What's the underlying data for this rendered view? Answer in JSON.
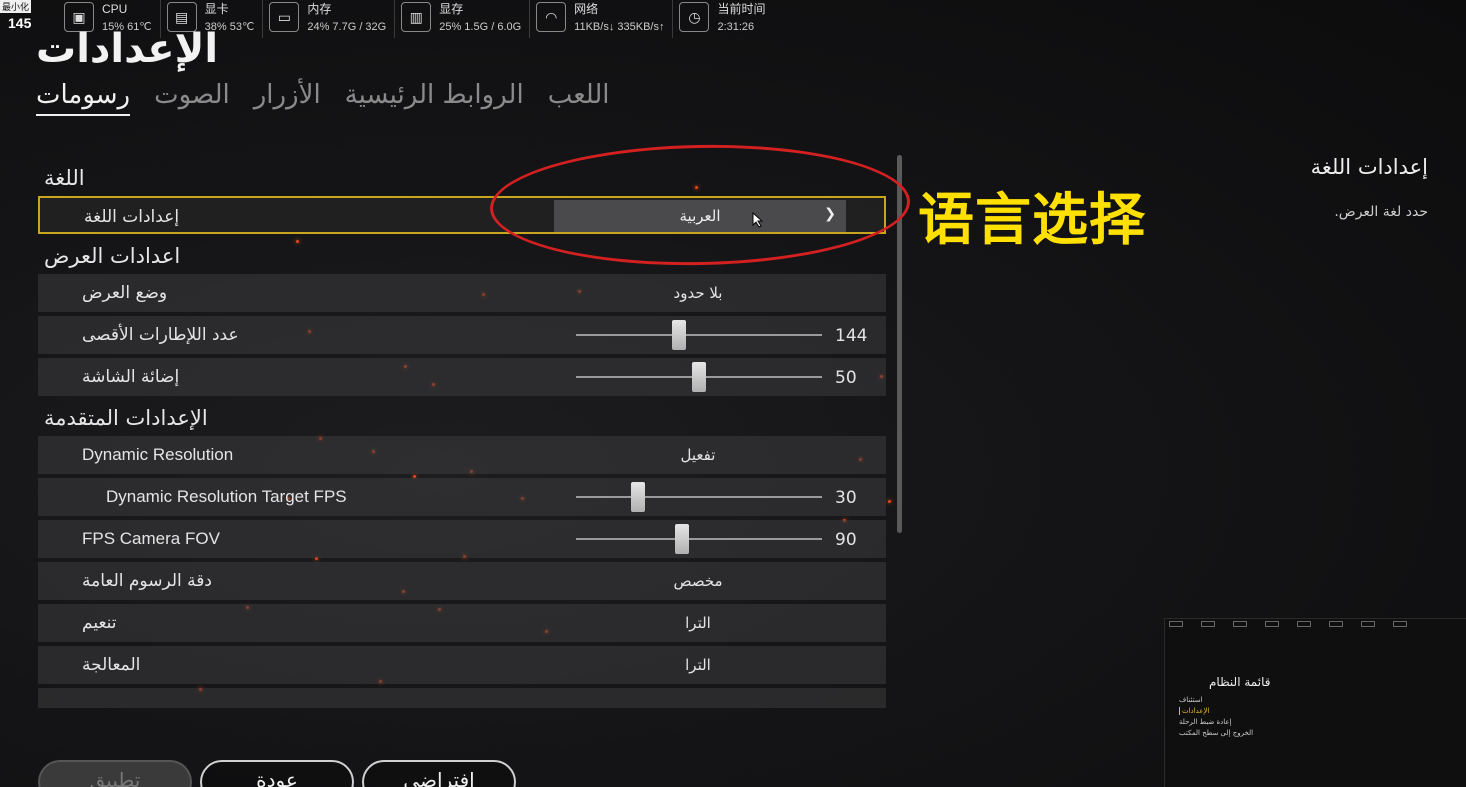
{
  "monitor": {
    "fps_tag": "最小化",
    "fps_value": "145",
    "items": [
      {
        "icon": "cpu-icon",
        "glyph": "▣",
        "name": "CPU",
        "values": "15%   61℃"
      },
      {
        "icon": "gpu-icon",
        "glyph": "▤",
        "name": "显卡",
        "values": "38%   53℃"
      },
      {
        "icon": "memory-icon",
        "glyph": "▭",
        "name": "内存",
        "values": "24%   7.7G / 32G"
      },
      {
        "icon": "vram-icon",
        "glyph": "▥",
        "name": "显存",
        "values": "25%   1.5G / 6.0G"
      },
      {
        "icon": "network-icon",
        "glyph": "◠",
        "name": "网络",
        "values": "11KB/s↓   335KB/s↑"
      },
      {
        "icon": "clock-icon",
        "glyph": "◷",
        "name": "当前时间",
        "values": "2:31:26"
      }
    ]
  },
  "page": {
    "title": "الإعدادات",
    "tabs": [
      "اللعب",
      "الروابط الرئيسية",
      "الأزرار",
      "الصوت",
      "رسومات"
    ]
  },
  "sections": {
    "language": {
      "title": "اللغة",
      "row_label": "إعدادات اللغة",
      "dropdown_value": "العربية"
    },
    "display": {
      "title": "اعدادات العرض",
      "rows": [
        {
          "label": "وضع العرض",
          "value": "بلا حدود"
        },
        {
          "label": "عدد اللإطارات الأقصى",
          "slider": 144,
          "slider_fraction": 0.42
        },
        {
          "label": "إضائة الشاشة",
          "slider": 50,
          "slider_fraction": 0.5
        }
      ]
    },
    "advanced": {
      "title": "الإعدادات المتقدمة",
      "rows": [
        {
          "label": "Dynamic Resolution",
          "value": "تفعيل"
        },
        {
          "label": "Dynamic Resolution Target FPS",
          "slider": 30,
          "slider_fraction": 0.25
        },
        {
          "label": "FPS Camera FOV",
          "slider": 90,
          "slider_fraction": 0.43
        },
        {
          "label": "دقة الرسوم العامة",
          "value": "مخصص"
        },
        {
          "label": "تنعيم",
          "value": "الترا"
        },
        {
          "label": "المعالجة",
          "value": "الترا"
        }
      ]
    }
  },
  "annotation": {
    "text": "语言选择"
  },
  "help": {
    "title": "إعدادات اللغة",
    "description": "حدد لغة العرض."
  },
  "buttons": {
    "apply": "تطبيق",
    "back": "عودة",
    "default": "افتراضي"
  },
  "thumbnail": {
    "title": "قائمة النظام",
    "items": [
      "استئناف",
      "الإعدادات",
      "إعادة ضبط الرحلة",
      "الخروج إلى سطح المكتب"
    ]
  },
  "colors": {
    "accent_gold": "#c9a41f",
    "annotation_red": "#d42020",
    "annotation_yellow": "#ffe000",
    "spark": "#e0461a"
  }
}
